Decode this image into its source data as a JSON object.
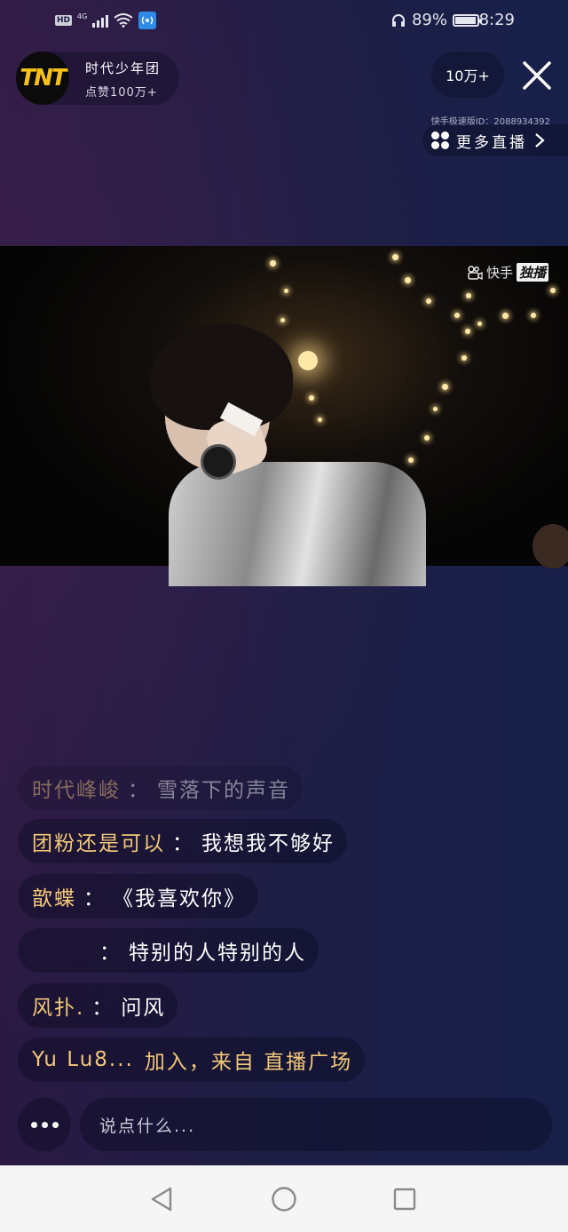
{
  "status_bar": {
    "hd": "HD",
    "network": "4G",
    "battery_text": "89%",
    "battery_level": 0.89,
    "time": "8:29"
  },
  "header": {
    "avatar_text": "TNT",
    "anchor_name": "时代少年团",
    "likes": "点赞100万+",
    "viewers": "10万+",
    "watermark_id": "快手极速版ID：2088934392",
    "more_live_label": "更多直播"
  },
  "video": {
    "platform": "快手",
    "platform_tag": "独播"
  },
  "comments": [
    {
      "name": "时代峰峻",
      "text": "雪落下的声音",
      "faded": true
    },
    {
      "name": "团粉还是可以",
      "text": "我想我不够好",
      "faded": false
    },
    {
      "name": "歆蝶",
      "text": "《我喜欢你》",
      "faded": false
    },
    {
      "name": "",
      "text": "特别的人特别的人",
      "faded": false
    },
    {
      "name": "风扑.",
      "text": "问风",
      "faded": false
    },
    {
      "name": "Yu Lu8...",
      "text": "加入，来自 直播广场",
      "faded": false
    }
  ],
  "input": {
    "placeholder": "说点什么..."
  },
  "colors": {
    "comment_name": "#f2c878",
    "accent_avatar": "#f6c21a"
  }
}
